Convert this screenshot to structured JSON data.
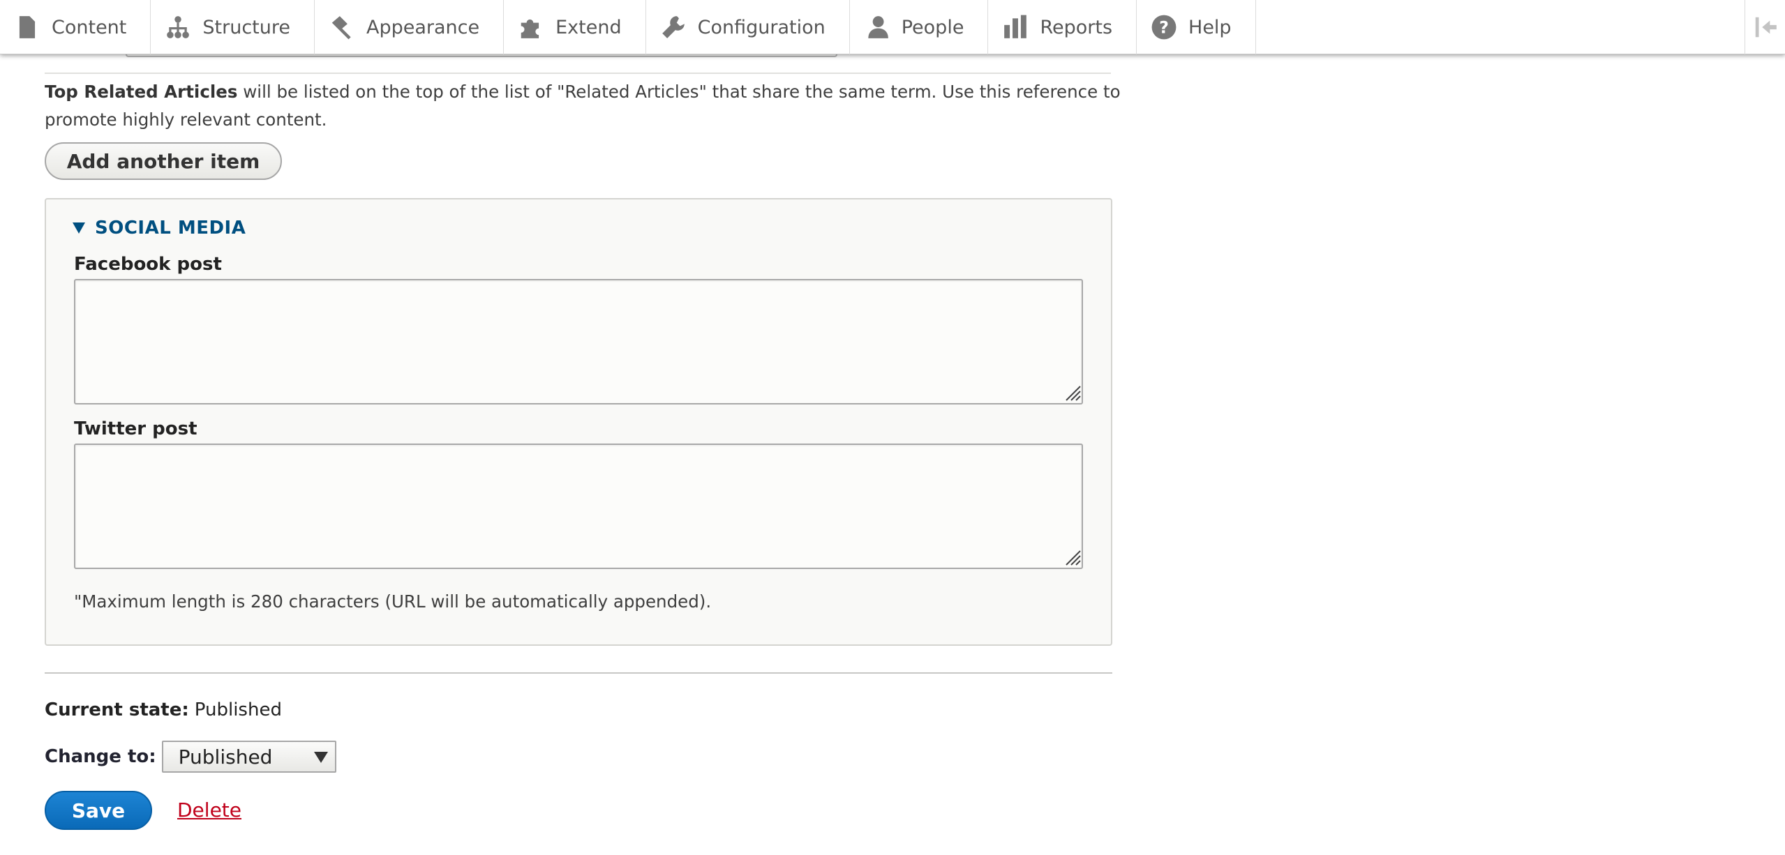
{
  "toolbar": {
    "items": [
      {
        "label": "Content",
        "icon": "file-icon"
      },
      {
        "label": "Structure",
        "icon": "sitemap-icon"
      },
      {
        "label": "Appearance",
        "icon": "paint-roller-icon"
      },
      {
        "label": "Extend",
        "icon": "puzzle-icon"
      },
      {
        "label": "Configuration",
        "icon": "wrench-icon"
      },
      {
        "label": "People",
        "icon": "person-icon"
      },
      {
        "label": "Reports",
        "icon": "bar-chart-icon"
      },
      {
        "label": "Help",
        "icon": "help-circle-icon"
      }
    ],
    "collapse_icon": "collapse-arrow-icon"
  },
  "related": {
    "description_bold": "Top Related Articles",
    "description_line1": " will be listed on the top of the list of \"Related Articles\" that share the same term. Use this reference to",
    "description_line2": "promote highly relevant content.",
    "add_button": "Add another item"
  },
  "social_media": {
    "legend": "SOCIAL MEDIA",
    "facebook_label": "Facebook post",
    "facebook_value": "",
    "twitter_label": "Twitter post",
    "twitter_value": "",
    "twitter_help": "\"Maximum length is 280 characters (URL will be automatically appended)."
  },
  "workflow": {
    "current_state_label": "Current state:",
    "current_state_value": "Published",
    "change_to_label": "Change to:",
    "change_to_value": "Published"
  },
  "actions": {
    "save": "Save",
    "delete": "Delete"
  },
  "colors": {
    "link_blue": "#004f80",
    "save_blue": "#0a6ab8",
    "delete_red": "#c0001a"
  }
}
